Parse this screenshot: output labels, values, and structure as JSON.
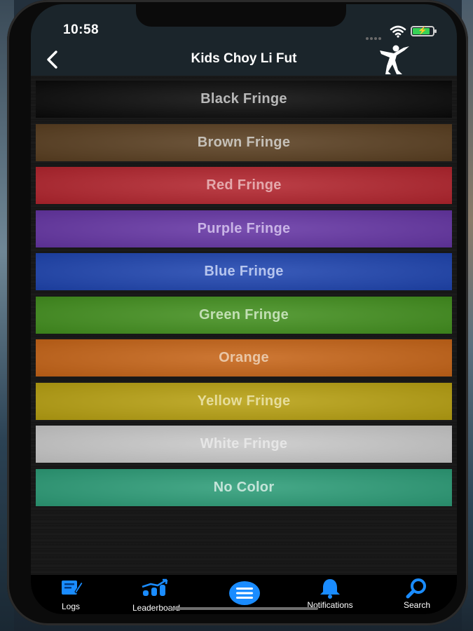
{
  "status_bar": {
    "time": "10:58"
  },
  "nav": {
    "title": "Kids Choy Li Fut",
    "back_icon": "chevron-left-icon",
    "logo_icon": "kung-fu-kick-icon"
  },
  "belts": [
    {
      "label": "Black Fringe",
      "bg": "#0a0a0a",
      "text": "#b9b9b9"
    },
    {
      "label": "Brown Fringe",
      "bg": "#5a3f21",
      "text": "#c5c0b8"
    },
    {
      "label": "Red Fringe",
      "bg": "#b3252e",
      "text": "#e4a9ac"
    },
    {
      "label": "Purple Fringe",
      "bg": "#6636a5",
      "text": "#c9b4e6"
    },
    {
      "label": "Blue Fringe",
      "bg": "#1f45b0",
      "text": "#b6c5ee"
    },
    {
      "label": "Green Fringe",
      "bg": "#43901f",
      "text": "#c2dfb4"
    },
    {
      "label": "Orange",
      "bg": "#c76518",
      "text": "#e9c6a6"
    },
    {
      "label": "Yellow Fringe",
      "bg": "#b8a112",
      "text": "#e6dd9c"
    },
    {
      "label": "White Fringe",
      "bg": "#c9c9c9",
      "text": "#e6e6e6"
    },
    {
      "label": "No Color",
      "bg": "#2d9d78",
      "text": "#c4e4d9"
    }
  ],
  "tabs": [
    {
      "label": "Logs",
      "icon": "logbook-icon"
    },
    {
      "label": "Leaderboard",
      "icon": "chart-trend-icon"
    },
    {
      "label": "",
      "icon": "menu-icon"
    },
    {
      "label": "Notifications",
      "icon": "bell-icon"
    },
    {
      "label": "Search",
      "icon": "search-icon"
    }
  ],
  "colors": {
    "accent": "#1a8cff",
    "bar": "#1b252b"
  }
}
